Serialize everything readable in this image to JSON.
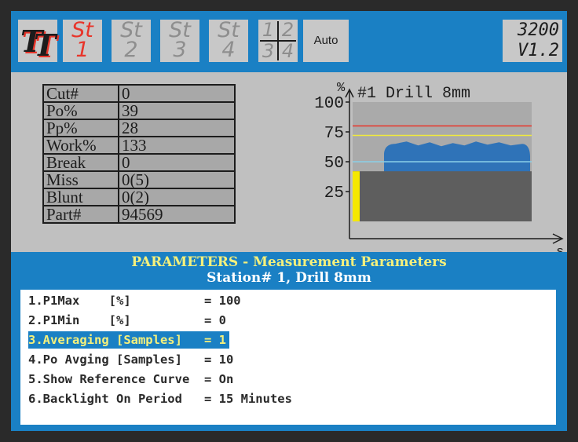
{
  "header": {
    "logo_text": "TT",
    "tabs": [
      {
        "line1": "St",
        "line2": "1",
        "active": true
      },
      {
        "line1": "St",
        "line2": "2",
        "active": false
      },
      {
        "line1": "St",
        "line2": "3",
        "active": false
      },
      {
        "line1": "St",
        "line2": "4",
        "active": false
      }
    ],
    "quad": [
      "1",
      "2",
      "3",
      "4"
    ],
    "auto_label": "Auto",
    "model": "3200",
    "version": "V1.2"
  },
  "stats": [
    {
      "label": "Cut#",
      "value": "0"
    },
    {
      "label": "Po%",
      "value": "39"
    },
    {
      "label": "Pp%",
      "value": "28"
    },
    {
      "label": "Work%",
      "value": "133"
    },
    {
      "label": "Break",
      "value": "0"
    },
    {
      "label": "Miss",
      "value": "0(5)"
    },
    {
      "label": "Blunt",
      "value": "0(2)"
    },
    {
      "label": "Part#",
      "value": "94569"
    }
  ],
  "chart_data": {
    "type": "area",
    "title": "#1 Drill 8mm",
    "y_unit": "%",
    "x_unit": "s",
    "y_ticks": [
      "100",
      "75",
      "50",
      "25"
    ],
    "ylim": [
      0,
      100
    ],
    "p1max_level": 80,
    "p1min_level": 72,
    "reference_level": 50,
    "base_fill_level": 42,
    "current_level": 42,
    "curve_level_approx": 65,
    "colors": {
      "plot_bg": "#aaaaaa",
      "curve": "#2f73b8",
      "base_fill": "#5e5e5e",
      "max_line": "#e8352a",
      "min_line": "#f0ea3c",
      "ref_line": "#8ad0e8",
      "current_bar": "#f5e800"
    }
  },
  "parameters": {
    "title": "PARAMETERS - Measurement Parameters",
    "subtitle": "Station# 1, Drill 8mm",
    "items": [
      {
        "label": "1.P1Max    [%]          ",
        "value": "100",
        "selected": false
      },
      {
        "label": "2.P1Min    [%]          ",
        "value": "0",
        "selected": false
      },
      {
        "label": "3.Averaging [Samples]   ",
        "value": "1",
        "selected": true
      },
      {
        "label": "4.Po Avging [Samples]   ",
        "value": "10",
        "selected": false
      },
      {
        "label": "5.Show Reference Curve  ",
        "value": "On",
        "selected": false
      },
      {
        "label": "6.Backlight On Period   ",
        "value": "15 Minutes",
        "selected": false
      }
    ]
  },
  "colors": {
    "frame": "#2a2a2a",
    "panel_blue": "#1a80c4",
    "panel_gray": "#c0c0c0",
    "title_yellow": "#f5f07c",
    "accent_red": "#e8352a"
  }
}
